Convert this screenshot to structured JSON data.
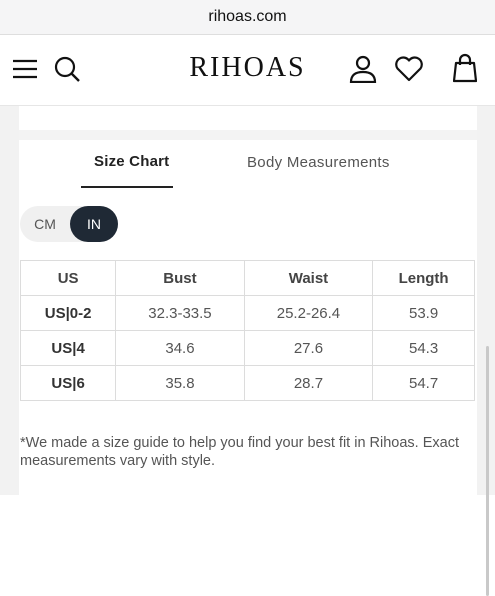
{
  "browser": {
    "url": "rihoas.com"
  },
  "header": {
    "logo": "RIHOAS",
    "icons": [
      "menu-icon",
      "search-icon",
      "account-icon",
      "wishlist-heart-icon",
      "bag-icon"
    ]
  },
  "tabs": [
    {
      "label": "Size Chart",
      "active": true
    },
    {
      "label": "Body Measurements",
      "active": false
    }
  ],
  "unit_toggle": {
    "cm_label": "CM",
    "in_label": "IN",
    "selected": "IN"
  },
  "size_table": {
    "headers": [
      "US",
      "Bust",
      "Waist",
      "Length"
    ],
    "rows": [
      {
        "size": "US|0-2",
        "bust": "32.3-33.5",
        "waist": "25.2-26.4",
        "length": "53.9"
      },
      {
        "size": "US|4",
        "bust": "34.6",
        "waist": "27.6",
        "length": "54.3"
      },
      {
        "size": "US|6",
        "bust": "35.8",
        "waist": "28.7",
        "length": "54.7"
      }
    ]
  },
  "note": "*We made a size guide to help you find your best fit in Rihoas. Exact measurements vary with style.",
  "colors": {
    "toggle_active_bg": "#1f2935",
    "tab_underline": "#222222",
    "table_border": "#dcdcdc"
  }
}
